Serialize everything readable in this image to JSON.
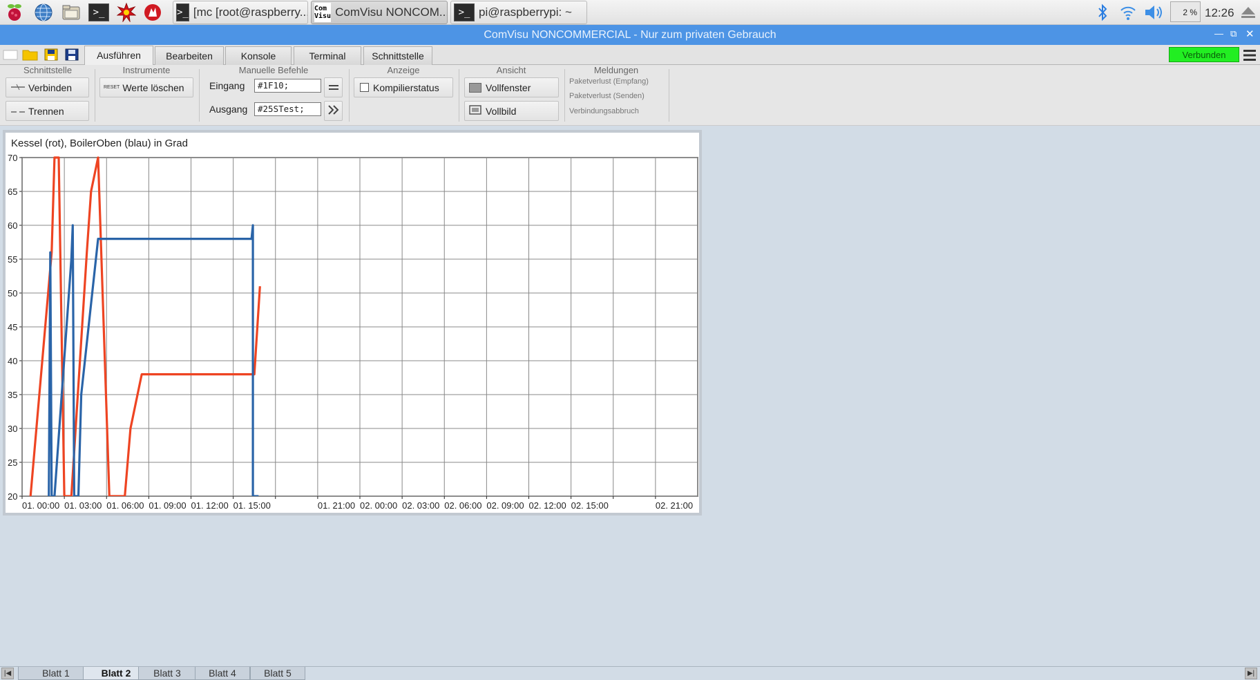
{
  "taskbar": {
    "launchers": [
      "raspberry-icon",
      "web-browser-icon",
      "file-manager-icon",
      "terminal-icon",
      "math-icon",
      "wolfram-icon"
    ],
    "tasks": [
      {
        "label": "[mc [root@raspberry...",
        "icon": "terminal-icon",
        "active": false
      },
      {
        "label": "ComVisu NONCOM...",
        "icon": "comvisu-icon",
        "icon_text": [
          "Com",
          "Visu"
        ],
        "active": true
      },
      {
        "label": "pi@raspberrypi: ~",
        "icon": "terminal-icon",
        "active": false
      }
    ],
    "term_glyph": ">_",
    "cpu": "2 %",
    "clock": "12:26"
  },
  "window": {
    "title": "ComVisu NONCOMMERCIAL - Nur zum privaten Gebrauch",
    "title_color": "#4d94e5"
  },
  "tabs": [
    "Ausführen",
    "Bearbeiten",
    "Konsole",
    "Terminal",
    "Schnittstelle"
  ],
  "active_tab": "Ausführen",
  "status": {
    "label": "Verbunden",
    "color": "#22ee22"
  },
  "ribbon": {
    "schnittstelle": {
      "title": "Schnittstelle",
      "connect": "Verbinden",
      "disconnect": "Trennen"
    },
    "instrumente": {
      "title": "Instrumente",
      "reset_tag": "RESET",
      "clear": "Werte löschen"
    },
    "manuell": {
      "title": "Manuelle Befehle",
      "input_label": "Eingang",
      "input_value": "#1F10;",
      "output_label": "Ausgang",
      "output_value": "#25STest;"
    },
    "anzeige": {
      "title": "Anzeige",
      "compile_status": "Kompilierstatus",
      "compile_checked": false
    },
    "ansicht": {
      "title": "Ansicht",
      "fullwindow": "Vollfenster",
      "fullscreen": "Vollbild"
    },
    "meldungen": {
      "title": "Meldungen",
      "items": [
        "Paketverlust (Empfang)",
        "Paketverlust (Senden)",
        "Verbindungsabbruch"
      ]
    }
  },
  "chart_data": {
    "type": "line",
    "title": "Kessel (rot), BoilerOben (blau) in Grad",
    "xlabel": "",
    "ylabel": "",
    "ylim": [
      20,
      70
    ],
    "yticks": [
      20,
      25,
      30,
      35,
      40,
      45,
      50,
      55,
      60,
      65,
      70
    ],
    "x_tick_labels": [
      "01. 00:00",
      "01. 03:00",
      "01. 06:00",
      "01. 09:00",
      "01. 12:00",
      "01. 15:00",
      "",
      "01. 21:00",
      "02. 00:00",
      "02. 03:00",
      "02. 06:00",
      "02. 09:00",
      "02. 12:00",
      "02. 15:00",
      "",
      "02. 21:00"
    ],
    "x_hour_range": [
      0,
      48
    ],
    "grid": true,
    "series": [
      {
        "color": "#ee4422",
        "points": [
          [
            0.6,
            20
          ],
          [
            2.1,
            56
          ],
          [
            2.3,
            70
          ],
          [
            2.6,
            70
          ],
          [
            3.0,
            20
          ],
          [
            3.5,
            20
          ],
          [
            4.6,
            56
          ],
          [
            4.9,
            65
          ],
          [
            5.4,
            70
          ],
          [
            6.2,
            20
          ],
          [
            7.3,
            20
          ],
          [
            7.7,
            30
          ],
          [
            8.5,
            38
          ],
          [
            16.5,
            38
          ],
          [
            16.9,
            51
          ]
        ]
      },
      {
        "color": "#2a64a8",
        "points": [
          [
            1.9,
            20
          ],
          [
            2.0,
            56
          ],
          [
            2.1,
            20
          ],
          [
            2.3,
            20
          ],
          [
            3.5,
            55
          ],
          [
            3.6,
            60
          ],
          [
            3.7,
            20
          ],
          [
            4.0,
            20
          ],
          [
            4.2,
            35
          ],
          [
            5.4,
            58
          ],
          [
            16.3,
            58
          ],
          [
            16.4,
            60
          ],
          [
            16.4,
            20
          ],
          [
            16.8,
            20
          ]
        ]
      }
    ]
  },
  "sheets": [
    "Blatt 1",
    "Blatt 2",
    "Blatt 3",
    "Blatt 4",
    "Blatt 5"
  ],
  "active_sheet": "Blatt 2"
}
